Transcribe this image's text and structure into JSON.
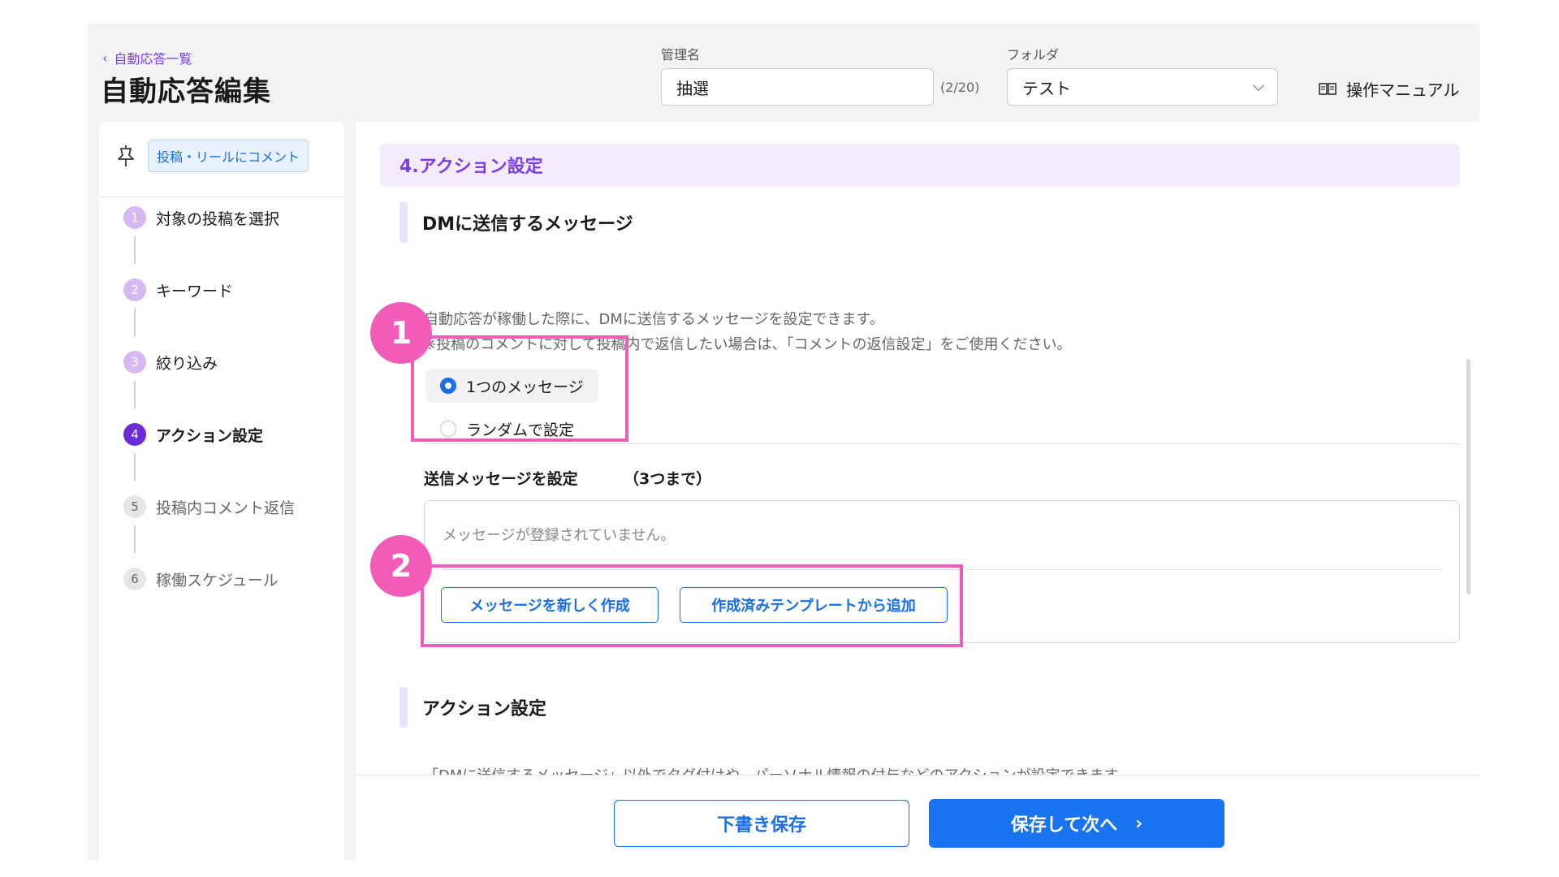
{
  "header": {
    "back_label": "自動応答一覧",
    "title": "自動応答編集",
    "name_label": "管理名",
    "name_value": "抽選",
    "name_count": "(2/20)",
    "folder_label": "フォルダ",
    "folder_value": "テスト",
    "manual_label": "操作マニュアル"
  },
  "sidebar": {
    "trigger_label": "投稿・リールにコメント",
    "steps": [
      {
        "num": "1",
        "label": "対象の投稿を選択",
        "state": "done"
      },
      {
        "num": "2",
        "label": "キーワード",
        "state": "done"
      },
      {
        "num": "3",
        "label": "絞り込み",
        "state": "done"
      },
      {
        "num": "4",
        "label": "アクション設定",
        "state": "active"
      },
      {
        "num": "5",
        "label": "投稿内コメント返信",
        "state": "todo"
      },
      {
        "num": "6",
        "label": "稼働スケジュール",
        "state": "todo"
      }
    ]
  },
  "main": {
    "section_title": "4.アクション設定",
    "dm_heading": "DMに送信するメッセージ",
    "dm_desc_1": "自動応答が稼働した際に、DMに送信するメッセージを設定できます。",
    "dm_desc_2": "※投稿のコメントに対して投稿内で返信したい場合は、「コメントの返信設定」をご使用ください。",
    "radio_options": [
      {
        "label": "1つのメッセージ",
        "selected": true
      },
      {
        "label": "ランダムで設定",
        "selected": false
      }
    ],
    "msg_title": "送信メッセージを設定",
    "msg_limit": "（3つまで）",
    "msg_empty": "メッセージが登録されていません。",
    "btn_new": "メッセージを新しく作成",
    "btn_template": "作成済みテンプレートから追加",
    "action_heading": "アクション設定",
    "action_desc_cut": "「DMに送信するメッセージ」以外でタグ付けや、パーソナル情報の付与などのアクションが設定できます。"
  },
  "footer": {
    "draft_label": "下書き保存",
    "next_label": "保存して次へ"
  },
  "annotations": {
    "marker_1": "1",
    "marker_2": "2"
  },
  "colors": {
    "accent_purple": "#7b3fe4",
    "primary_blue": "#1a74f0",
    "annotation_pink": "#f35bb9"
  }
}
